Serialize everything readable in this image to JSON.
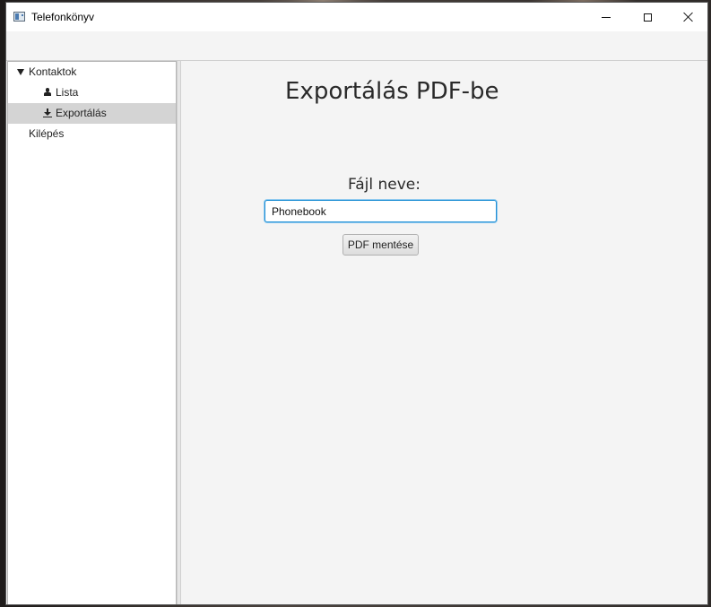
{
  "window": {
    "title": "Telefonkönyv"
  },
  "sidebar": {
    "items": [
      {
        "label": "Kontaktok",
        "icon": "triangle-down-icon",
        "expanded": true
      },
      {
        "label": "Lista",
        "icon": "user-icon"
      },
      {
        "label": "Exportálás",
        "icon": "download-icon",
        "selected": true
      },
      {
        "label": "Kilépés"
      }
    ]
  },
  "main": {
    "title": "Exportálás PDF-be",
    "file_label": "Fájl neve:",
    "file_input_value": "Phonebook",
    "save_button_label": "PDF mentése"
  },
  "colors": {
    "focus_border": "#1e8ed4",
    "selection": "#d4d4d4",
    "panel_bg": "#f4f4f4"
  }
}
